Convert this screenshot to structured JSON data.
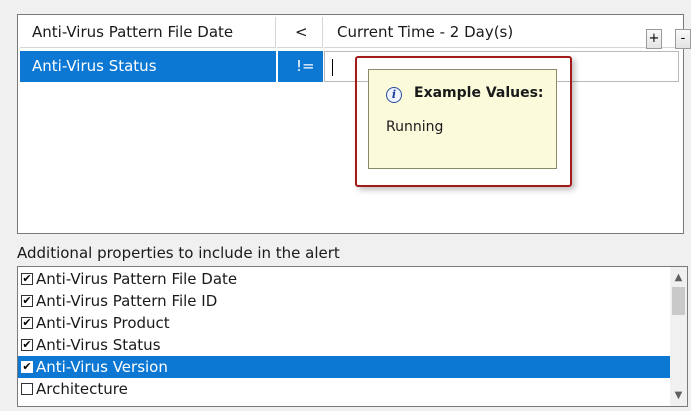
{
  "conditions": [
    {
      "property": "Anti-Virus Pattern File Date",
      "operator": "<",
      "value": "Current Time - 2 Day(s)"
    },
    {
      "property": "Anti-Virus Status",
      "operator": "!=",
      "value": ""
    }
  ],
  "buttons": {
    "plus": "+",
    "minus": "-"
  },
  "tooltip": {
    "icon": "info-icon",
    "title": "Example Values:",
    "body": "Running"
  },
  "additional": {
    "label": "Additional properties to include in the alert",
    "items": [
      {
        "label": "Anti-Virus Pattern File Date",
        "checked": true,
        "selected": false
      },
      {
        "label": "Anti-Virus Pattern File ID",
        "checked": true,
        "selected": false
      },
      {
        "label": "Anti-Virus Product",
        "checked": true,
        "selected": false
      },
      {
        "label": "Anti-Virus Status",
        "checked": true,
        "selected": false
      },
      {
        "label": "Anti-Virus Version",
        "checked": true,
        "selected": true
      },
      {
        "label": "Architecture",
        "checked": false,
        "selected": false
      }
    ]
  },
  "colors": {
    "selection": "#0d78d4",
    "tooltip_bg": "#fbfbdc",
    "highlight_frame": "#a31a1a"
  }
}
